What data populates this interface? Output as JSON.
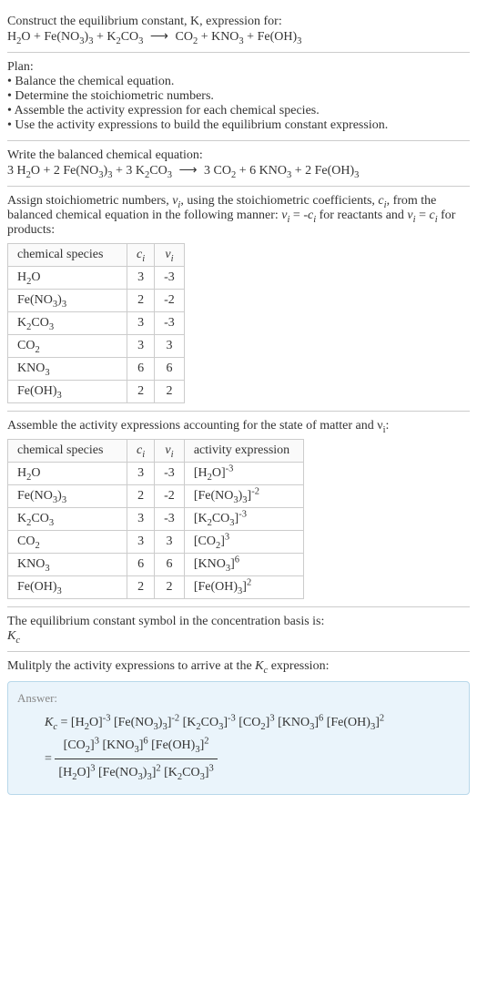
{
  "header": {
    "line1": "Construct the equilibrium constant, K, expression for:",
    "equation_parts": {
      "lhs": [
        "H",
        "2",
        "O",
        " + ",
        "Fe(NO",
        "3",
        ")",
        "3",
        " + ",
        "K",
        "2",
        "CO",
        "3"
      ],
      "arrow": "⟶",
      "rhs": [
        "CO",
        "2",
        " + ",
        "KNO",
        "3",
        " + ",
        "Fe(OH)",
        "3"
      ]
    }
  },
  "plan": {
    "title": "Plan:",
    "items": [
      "Balance the chemical equation.",
      "Determine the stoichiometric numbers.",
      "Assemble the activity expression for each chemical species.",
      "Use the activity expressions to build the equilibrium constant expression."
    ]
  },
  "balanced": {
    "title": "Write the balanced chemical equation:",
    "c": {
      "h2o": "3",
      "fe": "2",
      "k2co3": "3",
      "co2": "3",
      "kno3": "6",
      "feoh3": "2"
    },
    "arrow": "⟶"
  },
  "stoich": {
    "title_prefix": "Assign stoichiometric numbers, ",
    "title_mid1": ", using the stoichiometric coefficients, ",
    "title_mid2": ", from the balanced chemical equation in the following manner: ",
    "title_react": " for reactants and ",
    "title_prod": " for products:",
    "headers": {
      "species": "chemical species",
      "ci": "c",
      "vi": "ν"
    },
    "rows": [
      {
        "name": "H2O",
        "ci": "3",
        "vi": "-3"
      },
      {
        "name": "Fe(NO3)3",
        "ci": "2",
        "vi": "-2"
      },
      {
        "name": "K2CO3",
        "ci": "3",
        "vi": "-3"
      },
      {
        "name": "CO2",
        "ci": "3",
        "vi": "3"
      },
      {
        "name": "KNO3",
        "ci": "6",
        "vi": "6"
      },
      {
        "name": "Fe(OH)3",
        "ci": "2",
        "vi": "2"
      }
    ]
  },
  "activity": {
    "title": "Assemble the activity expressions accounting for the state of matter and ν",
    "title_sub": "i",
    "title_end": ":",
    "headers": {
      "species": "chemical species",
      "ci": "c",
      "vi": "ν",
      "act": "activity expression"
    },
    "rows": [
      {
        "name": "H2O",
        "ci": "3",
        "vi": "-3",
        "exp": "-3"
      },
      {
        "name": "Fe(NO3)3",
        "ci": "2",
        "vi": "-2",
        "exp": "-2"
      },
      {
        "name": "K2CO3",
        "ci": "3",
        "vi": "-3",
        "exp": "-3"
      },
      {
        "name": "CO2",
        "ci": "3",
        "vi": "3",
        "exp": "3"
      },
      {
        "name": "KNO3",
        "ci": "6",
        "vi": "6",
        "exp": "6"
      },
      {
        "name": "Fe(OH)3",
        "ci": "2",
        "vi": "2",
        "exp": "2"
      }
    ]
  },
  "kc_symbol": {
    "line1": "The equilibrium constant symbol in the concentration basis is:",
    "sym": "K",
    "sub": "c"
  },
  "multiply": {
    "title_prefix": "Mulitply the activity expressions to arrive at the ",
    "title_end": " expression:"
  },
  "answer": {
    "label": "Answer:",
    "exp": {
      "h2o": "-3",
      "fe": "-2",
      "k2co3": "-3",
      "co2": "3",
      "kno3": "6",
      "feoh3": "2"
    },
    "num_exp": {
      "co2": "3",
      "kno3": "6",
      "feoh3": "2"
    },
    "den_exp": {
      "h2o": "3",
      "fe": "2",
      "k2co3": "3"
    }
  },
  "chart_data": {
    "type": "table",
    "title": "Stoichiometric coefficients and numbers",
    "columns": [
      "chemical species",
      "c_i",
      "ν_i"
    ],
    "rows": [
      [
        "H2O",
        3,
        -3
      ],
      [
        "Fe(NO3)3",
        2,
        -2
      ],
      [
        "K2CO3",
        3,
        -3
      ],
      [
        "CO2",
        3,
        3
      ],
      [
        "KNO3",
        6,
        6
      ],
      [
        "Fe(OH)3",
        2,
        2
      ]
    ]
  }
}
